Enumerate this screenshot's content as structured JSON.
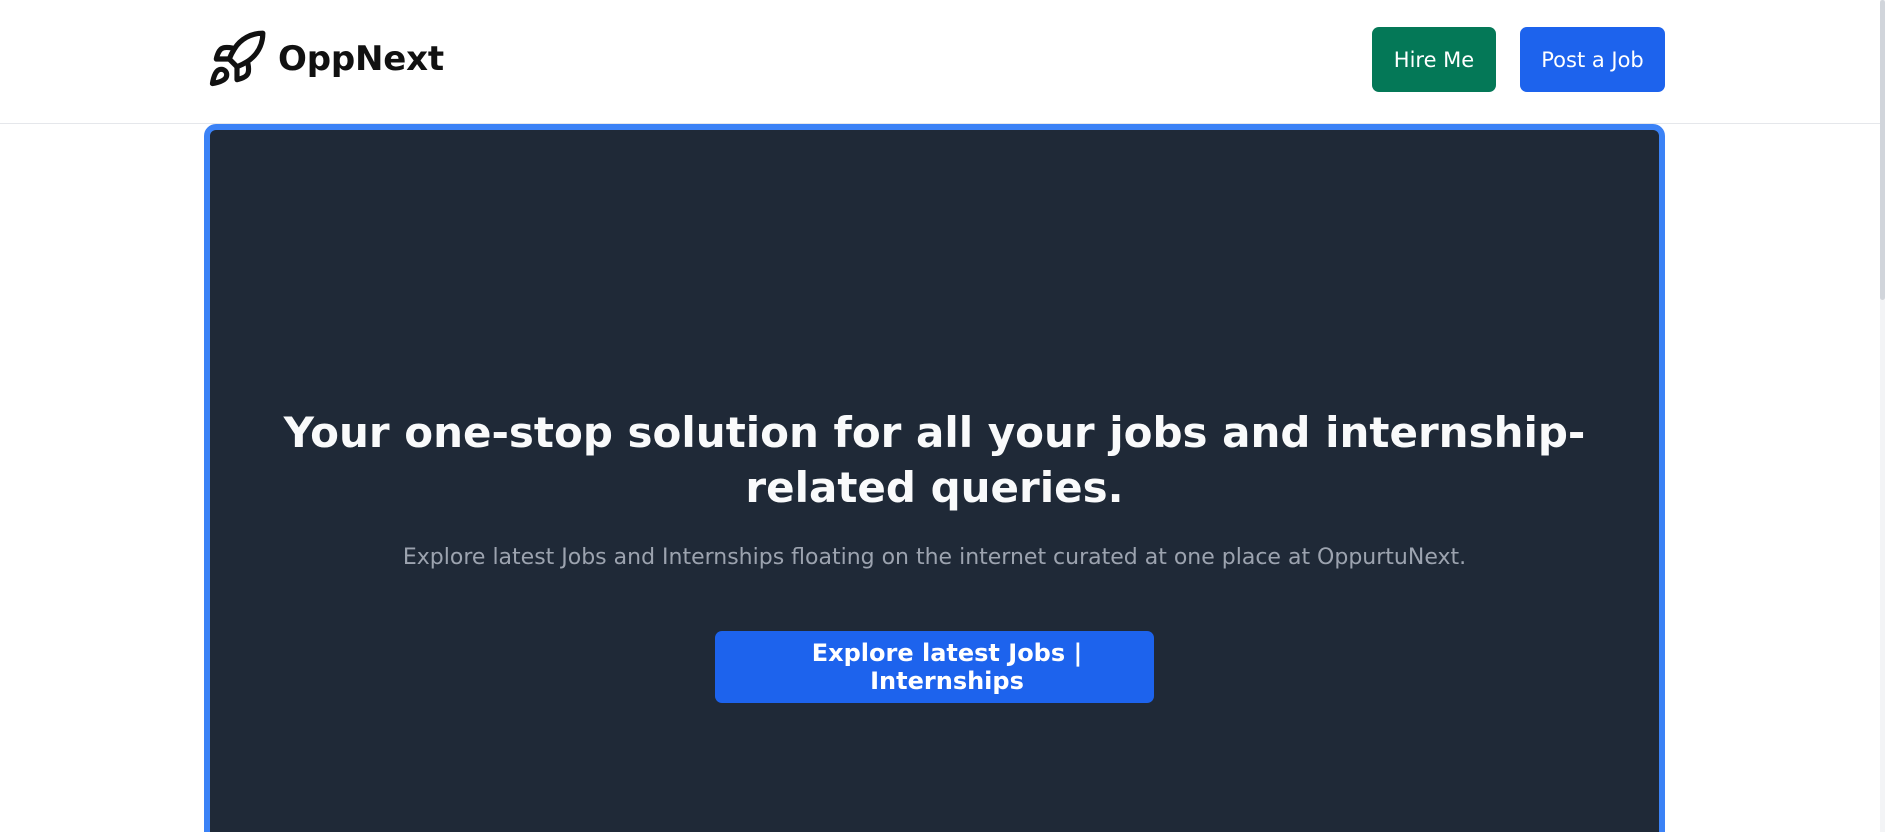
{
  "header": {
    "brand_name": "OppNext",
    "brand_icon": "rocket-icon",
    "hire_label": "Hire Me",
    "post_label": "Post a Job"
  },
  "hero": {
    "title": "Your one-stop solution for all your jobs and internship-related queries.",
    "subtitle": "Explore latest Jobs and Internships floating on the internet curated at one place at OppurtuNext.",
    "cta_label": "Explore latest Jobs | Internships"
  },
  "colors": {
    "hire_button": "#047857",
    "primary_button": "#1d63ed",
    "hero_background": "#1f2937",
    "hero_border": "#3b82f6"
  }
}
